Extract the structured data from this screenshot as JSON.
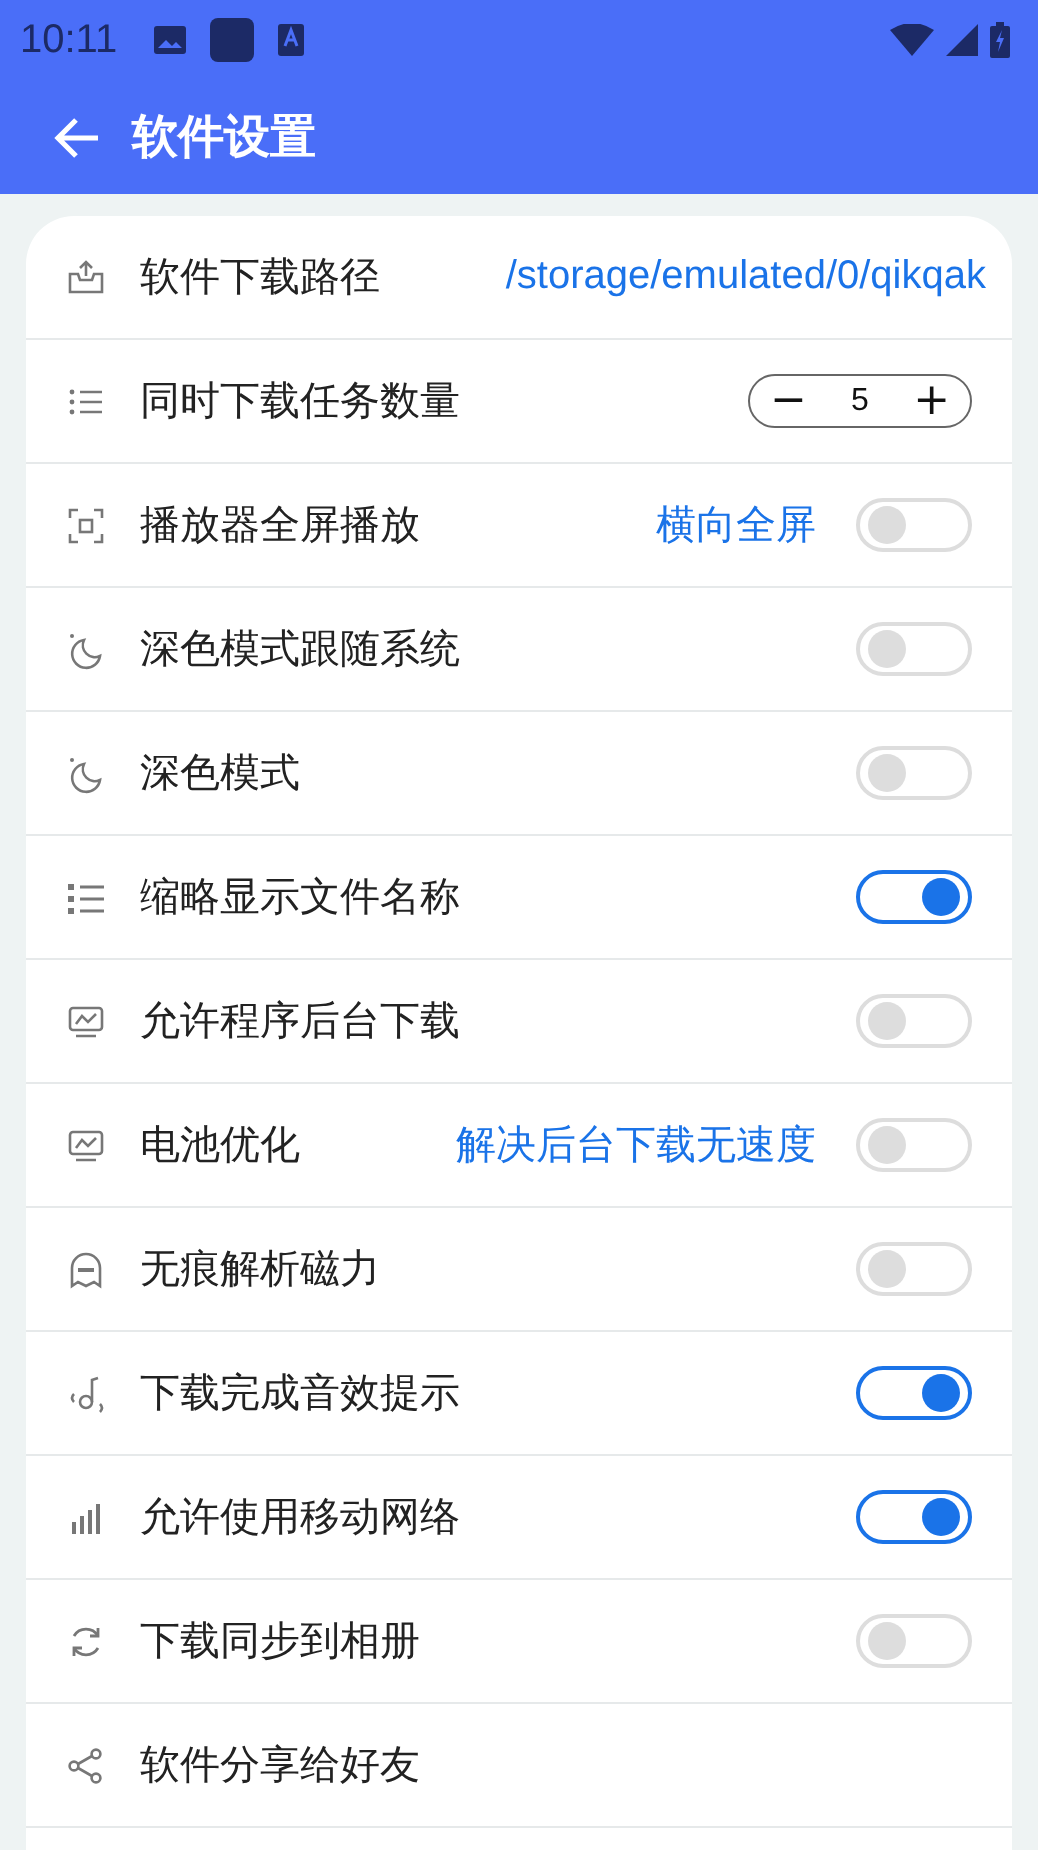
{
  "status_bar": {
    "time": "10:11"
  },
  "app_bar": {
    "title": "软件设置"
  },
  "rows": [
    {
      "kind": "path",
      "label": "软件下载路径",
      "value": "/storage/emulated/0/qikqak"
    },
    {
      "kind": "stepper",
      "label": "同时下载任务数量",
      "minus": "−",
      "value": "5",
      "plus": "+"
    },
    {
      "kind": "switch",
      "label": "播放器全屏播放",
      "note": "横向全屏",
      "on": false
    },
    {
      "kind": "switch",
      "label": "深色模式跟随系统",
      "on": false
    },
    {
      "kind": "switch",
      "label": "深色模式",
      "on": false
    },
    {
      "kind": "switch",
      "label": "缩略显示文件名称",
      "on": true
    },
    {
      "kind": "switch",
      "label": "允许程序后台下载",
      "on": false
    },
    {
      "kind": "switch",
      "label": "电池优化",
      "note": "解决后台下载无速度",
      "on": false
    },
    {
      "kind": "switch",
      "label": "无痕解析磁力",
      "on": false
    },
    {
      "kind": "switch",
      "label": "下载完成音效提示",
      "on": true
    },
    {
      "kind": "switch",
      "label": "允许使用移动网络",
      "on": true
    },
    {
      "kind": "switch",
      "label": "下载同步到相册",
      "on": false
    },
    {
      "kind": "plain",
      "label": "软件分享给好友"
    }
  ]
}
